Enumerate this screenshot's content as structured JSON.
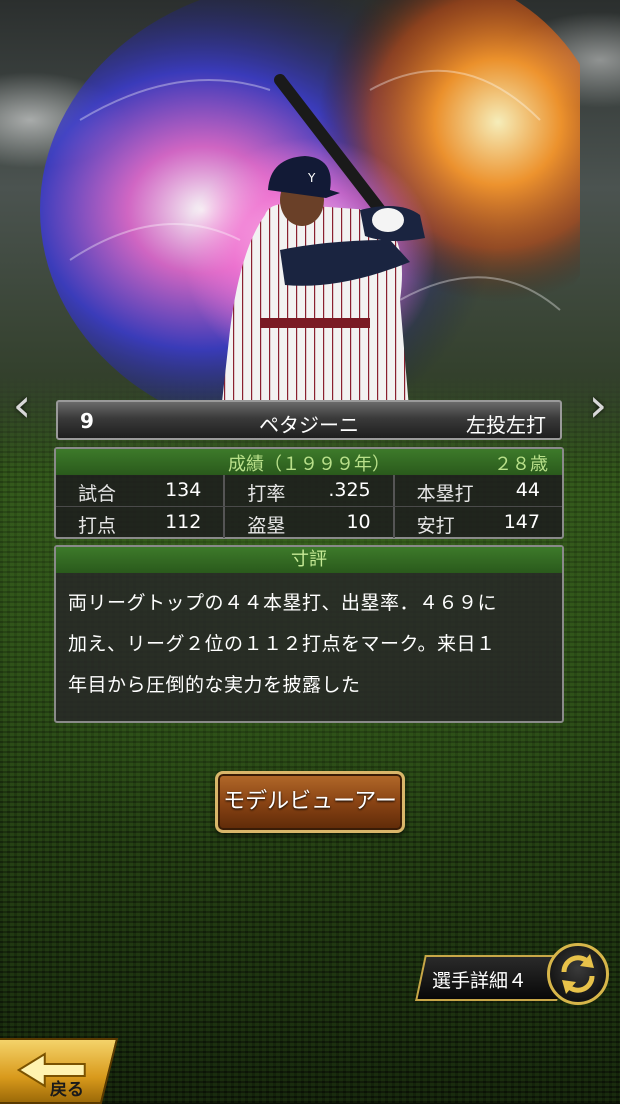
{
  "player": {
    "number": "9",
    "name": "ペタジーニ",
    "throw_bat": "左投左打"
  },
  "stats": {
    "season": "成績（１９９９年）",
    "age": "２８歳",
    "rows": [
      [
        {
          "label": "試合",
          "value": "134"
        },
        {
          "label": "打率",
          "value": ".325"
        },
        {
          "label": "本塁打",
          "value": "44"
        }
      ],
      [
        {
          "label": "打点",
          "value": "112"
        },
        {
          "label": "盗塁",
          "value": "10"
        },
        {
          "label": "安打",
          "value": "147"
        }
      ]
    ]
  },
  "comment": {
    "title": "寸評",
    "lines": [
      "両リーグトップの４４本塁打、出塁率．４６９に",
      "加え、リーグ２位の１１２打点をマーク。来日１",
      "年目から圧倒的な実力を披露した"
    ]
  },
  "buttons": {
    "model_viewer": "モデルビューアー",
    "player_detail": "選手詳細４",
    "back": "戻る"
  },
  "icons": {
    "prev": "chevron-left-icon",
    "next": "chevron-right-icon",
    "cycle": "cycle-arrows-icon",
    "back": "back-arrow-icon"
  },
  "colors": {
    "panel_header_green": "#2a5a1c",
    "header_text_green": "#b9e08a",
    "button_gold": "#d9b66a",
    "button_brown": "#8a4414"
  }
}
